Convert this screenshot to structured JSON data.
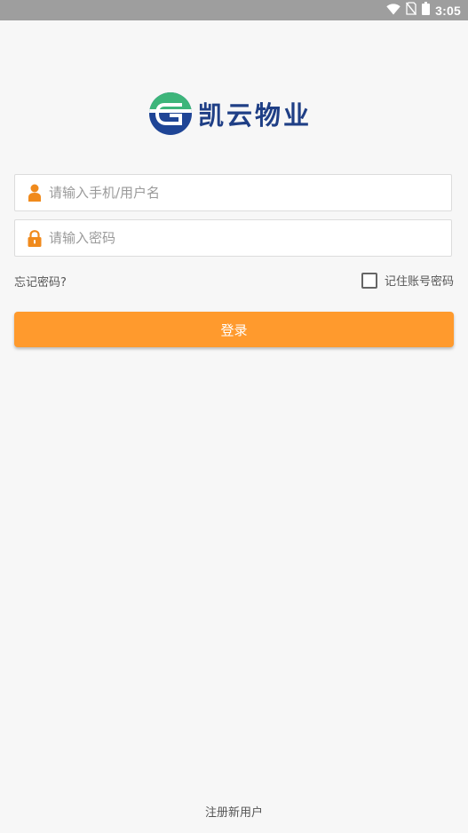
{
  "status_bar": {
    "time": "3:05",
    "icons": [
      "wifi-icon",
      "no-sim-icon",
      "battery-icon"
    ]
  },
  "brand": {
    "name": "凯云物业",
    "logo_icon": "kaiyun-logo-icon",
    "colors": {
      "text": "#1f3f86",
      "green": "#3db57a",
      "blue": "#1f4596"
    }
  },
  "login_form": {
    "username": {
      "placeholder": "请输入手机/用户名",
      "value": "",
      "icon": "user-icon"
    },
    "password": {
      "placeholder": "请输入密码",
      "value": "",
      "icon": "lock-icon"
    },
    "forgot_password": "忘记密码?",
    "remember": {
      "label": "记住账号密码",
      "checked": false
    },
    "submit_label": "登录"
  },
  "footer": {
    "register_label": "注册新用户"
  },
  "colors": {
    "accent": "#ff9a2d",
    "icon_orange": "#f08a1c",
    "background": "#f7f7f7"
  }
}
